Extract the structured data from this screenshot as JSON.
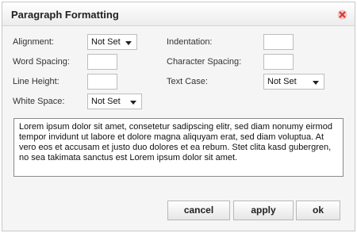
{
  "dialog": {
    "title": "Paragraph Formatting",
    "close_icon": "close-icon"
  },
  "form": {
    "alignment": {
      "label": "Alignment:",
      "value": "Not Set"
    },
    "indentation": {
      "label": "Indentation:",
      "value": ""
    },
    "word_spacing": {
      "label": "Word Spacing:",
      "value": ""
    },
    "character_spacing": {
      "label": "Character Spacing:",
      "value": ""
    },
    "line_height": {
      "label": "Line Height:",
      "value": ""
    },
    "text_case": {
      "label": "Text Case:",
      "value": "Not Set"
    },
    "white_space": {
      "label": "White Space:",
      "value": "Not Set"
    }
  },
  "preview": {
    "text": "Lorem ipsum dolor sit amet, consetetur sadipscing elitr, sed diam nonumy eirmod tempor invidunt ut labore et dolore magna aliquyam erat, sed diam voluptua. At vero eos et accusam et justo duo dolores et ea rebum. Stet clita kasd gubergren, no sea takimata sanctus est Lorem ipsum dolor sit amet."
  },
  "buttons": {
    "cancel": "cancel",
    "apply": "apply",
    "ok": "ok"
  },
  "colors": {
    "close_icon": "#d9534f"
  }
}
